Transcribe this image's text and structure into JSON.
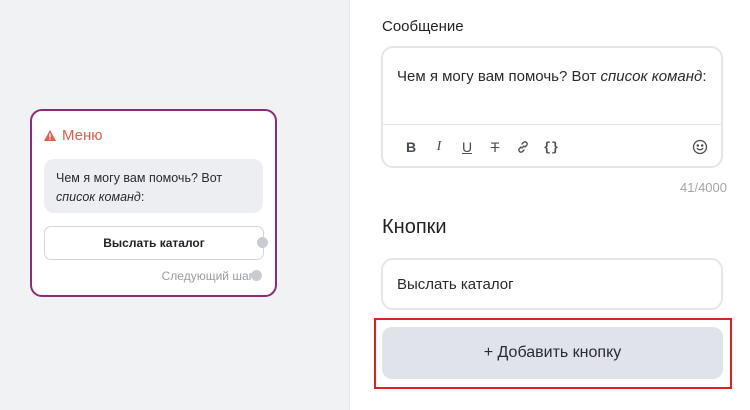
{
  "canvas": {
    "node": {
      "title": "Меню",
      "message_text": "Чем я могу вам помочь? Вот ",
      "message_italic": "список команд",
      "message_tail": ":",
      "button_label": "Выслать каталог",
      "next_step_label": "Следующий шаг"
    }
  },
  "panel": {
    "message_label": "Сообщение",
    "editor": {
      "text": "Чем я могу вам помочь? Вот ",
      "italic": "список команд",
      "tail": ":",
      "toolbar": {
        "bold": "B",
        "italic": "I",
        "underline": "U",
        "strike": "T",
        "code": "{}"
      }
    },
    "char_counter": "41/4000",
    "buttons_label": "Кнопки",
    "button_value": "Выслать каталог",
    "add_button_label": "+ Добавить кнопку"
  },
  "colors": {
    "node_border": "#8e2a77",
    "node_title": "#e25e4c",
    "highlight": "#e02020",
    "add_button_bg": "#e0e3ea"
  }
}
